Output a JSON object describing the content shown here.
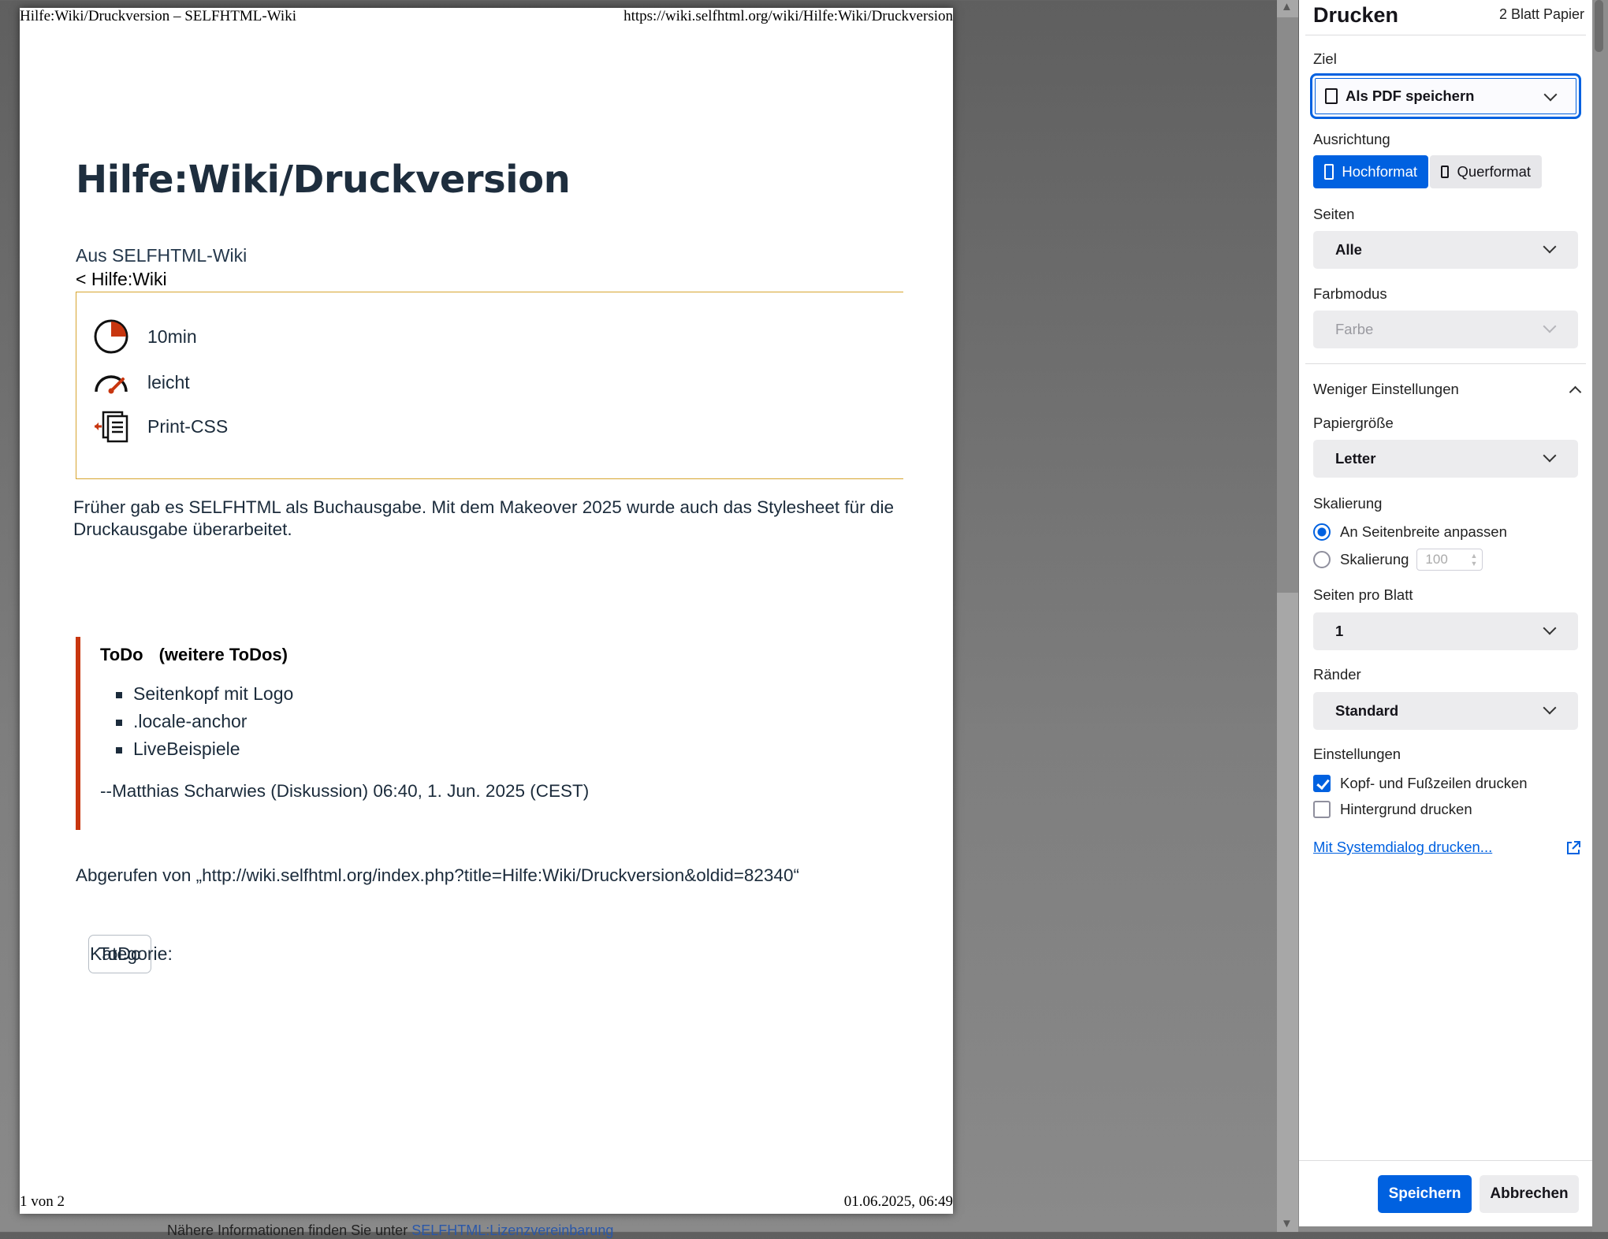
{
  "preview": {
    "header_left": "Hilfe:Wiki/Druckversion – SELFHTML-Wiki",
    "header_right": "https://wiki.selfhtml.org/wiki/Hilfe:Wiki/Druckversion",
    "footer_left": "1 von 2",
    "footer_right": "01.06.2025, 06:49",
    "title": "Hilfe:Wiki/Druckversion",
    "from": "Aus SELFHTML-Wiki",
    "breadcrumb": "< Hilfe:Wiki",
    "info": {
      "duration": "10min",
      "difficulty": "leicht",
      "topic": "Print-CSS"
    },
    "paragraph": "Früher gab es SELFHTML als Buchausgabe. Mit dem Makeover 2025 wurde auch das Stylesheet für die Druckausgabe überarbeitet.",
    "todo": {
      "heading": "ToDo",
      "more": "(weitere ToDos)",
      "items": [
        "Seitenkopf mit Logo",
        ".locale-anchor",
        "LiveBeispiele"
      ],
      "signature": "--Matthias Scharwies (Diskussion) 06:40, 1. Jun. 2025 (CEST)"
    },
    "retrieved": "Abgerufen von „http://wiki.selfhtml.org/index.php?title=Hilfe:Wiki/Druckversion&oldid=82340“",
    "category_label": "Kategorie:",
    "category_tag": "ToDo",
    "peek_text": "Nähere Informationen finden Sie unter",
    "peek_link": "SELFHTML:Lizenzvereinbarung"
  },
  "dialog": {
    "title": "Drucken",
    "sheets": "2 Blatt Papier",
    "destination_label": "Ziel",
    "destination_value": "Als PDF speichern",
    "orientation_label": "Ausrichtung",
    "portrait": "Hochformat",
    "landscape": "Querformat",
    "pages_label": "Seiten",
    "pages_value": "Alle",
    "color_label": "Farbmodus",
    "color_value": "Farbe",
    "less_settings": "Weniger Einstellungen",
    "paper_label": "Papiergröße",
    "paper_value": "Letter",
    "scale_label": "Skalierung",
    "scale_fit": "An Seitenbreite anpassen",
    "scale_custom": "Skalierung",
    "scale_value": "100",
    "per_sheet_label": "Seiten pro Blatt",
    "per_sheet_value": "1",
    "margins_label": "Ränder",
    "margins_value": "Standard",
    "options_label": "Einstellungen",
    "opt_headers": "Kopf- und Fußzeilen drucken",
    "opt_background": "Hintergrund drucken",
    "system_dialog": "Mit Systemdialog drucken...",
    "save": "Speichern",
    "cancel": "Abbrechen"
  },
  "colors": {
    "accent": "#0061e0",
    "todo_bar": "#c8360f",
    "infobox_border": "#d7a52f"
  }
}
